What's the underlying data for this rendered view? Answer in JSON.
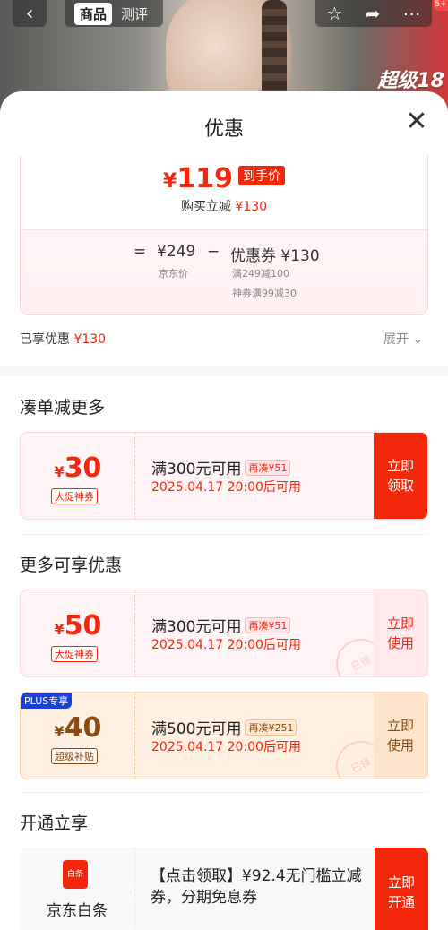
{
  "header": {
    "back_icon": "chevron-left-icon",
    "tabs": [
      {
        "label": "商品",
        "active": true
      },
      {
        "label": "测评",
        "active": false
      }
    ],
    "right_icons": [
      "star-icon",
      "share-icon",
      "more-icon"
    ],
    "badge": "5+",
    "promo_text": "超级18"
  },
  "sheet": {
    "title": "优惠",
    "close_icon": "close-icon"
  },
  "price_summary": {
    "symbol": "¥",
    "final_price": "119",
    "final_tag": "到手价",
    "reduce_label": "购买立减",
    "reduce_amount": "¥130",
    "eq": "=",
    "jd_price": "¥249",
    "jd_price_label": "京东价",
    "minus": "−",
    "coupon_label": "优惠券",
    "coupon_amount": "¥130",
    "coupon_note_1": "满249减100",
    "coupon_note_2": "神券满99减30"
  },
  "enjoyed": {
    "label": "已享优惠",
    "amount": "¥130",
    "expand": "展开 ⌄"
  },
  "section_stack": {
    "title": "凑单减更多"
  },
  "section_more": {
    "title": "更多可享优惠"
  },
  "section_open": {
    "title": "开通立享"
  },
  "coupons": [
    {
      "symbol": "¥",
      "amount": "30",
      "kind": "大促神券",
      "condition": "满300元可用",
      "more": "再凑¥51",
      "time": "2025.04.17 20:00后可用",
      "action": "立即\n领取",
      "style": "red",
      "action_style": "solid"
    },
    {
      "symbol": "¥",
      "amount": "50",
      "kind": "大促神券",
      "condition": "满300元可用",
      "more": "再凑¥51",
      "time": "2025.04.17 20:00后可用",
      "action": "立即\n使用",
      "style": "red",
      "action_style": "soft",
      "stamp": "已领"
    },
    {
      "symbol": "¥",
      "amount": "40",
      "kind": "超级补贴",
      "condition": "满500元可用",
      "more": "再凑¥251",
      "time": "2025.04.17 20:00后可用",
      "action": "立即\n使用",
      "style": "gold",
      "action_style": "soft",
      "stamp": "已领",
      "plus_tag": "PLUS专享"
    }
  ],
  "baitiao": {
    "logo_text": "白条",
    "name": "京东白条",
    "desc": "【点击领取】¥92.4无门槛立减券，分期免息券",
    "action": "立即\n开通"
  }
}
